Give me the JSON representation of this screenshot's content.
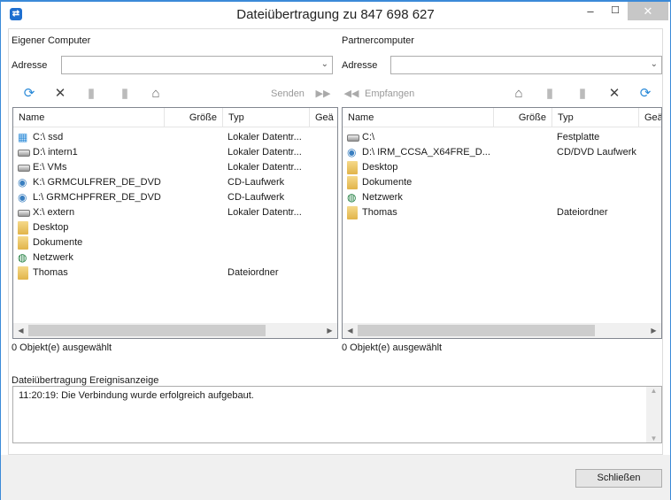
{
  "window": {
    "title": "Dateiübertragung zu 847 698 627",
    "minimize": "–",
    "maximize": "☐",
    "close": "✕"
  },
  "columns": [
    "Name",
    "Größe",
    "Typ",
    "Geä"
  ],
  "local": {
    "title": "Eigener Computer",
    "address_label": "Adresse",
    "address_value": "",
    "send_label": "Senden",
    "items": [
      {
        "name": "C:\\ ssd",
        "type": "Lokaler Datentr...",
        "icon": "windows-drive-icon"
      },
      {
        "name": "D:\\ intern1",
        "type": "Lokaler Datentr...",
        "icon": "drive-icon"
      },
      {
        "name": "E:\\ VMs",
        "type": "Lokaler Datentr...",
        "icon": "drive-icon"
      },
      {
        "name": "K:\\ GRMCULFRER_DE_DVD",
        "type": "CD-Laufwerk",
        "icon": "dvd-icon"
      },
      {
        "name": "L:\\ GRMCHPFRER_DE_DVD",
        "type": "CD-Laufwerk",
        "icon": "dvd-icon"
      },
      {
        "name": "X:\\ extern",
        "type": "Lokaler Datentr...",
        "icon": "drive-icon"
      },
      {
        "name": "Desktop",
        "type": "",
        "icon": "desktop-folder-icon"
      },
      {
        "name": "Dokumente",
        "type": "",
        "icon": "documents-folder-icon"
      },
      {
        "name": "Netzwerk",
        "type": "",
        "icon": "network-icon"
      },
      {
        "name": "Thomas",
        "type": "Dateiordner",
        "icon": "folder-icon"
      }
    ],
    "status": "0 Objekt(e) ausgewählt"
  },
  "remote": {
    "title": "Partnercomputer",
    "address_label": "Adresse",
    "address_value": "",
    "receive_label": "Empfangen",
    "items": [
      {
        "name": "C:\\",
        "type": "Festplatte",
        "icon": "drive-icon"
      },
      {
        "name": "D:\\ IRM_CCSA_X64FRE_D...",
        "type": "CD/DVD Laufwerk",
        "icon": "dvd-icon"
      },
      {
        "name": "Desktop",
        "type": "",
        "icon": "desktop-folder-icon"
      },
      {
        "name": "Dokumente",
        "type": "",
        "icon": "documents-folder-icon"
      },
      {
        "name": "Netzwerk",
        "type": "",
        "icon": "network-icon"
      },
      {
        "name": "Thomas",
        "type": "Dateiordner",
        "icon": "folder-icon"
      }
    ],
    "status": "0 Objekt(e) ausgewählt"
  },
  "log": {
    "title": "Dateiübertragung Ereignisanzeige",
    "entries": [
      "11:20:19: Die Verbindung wurde erfolgreich aufgebaut."
    ]
  },
  "footer": {
    "close_label": "Schließen"
  }
}
